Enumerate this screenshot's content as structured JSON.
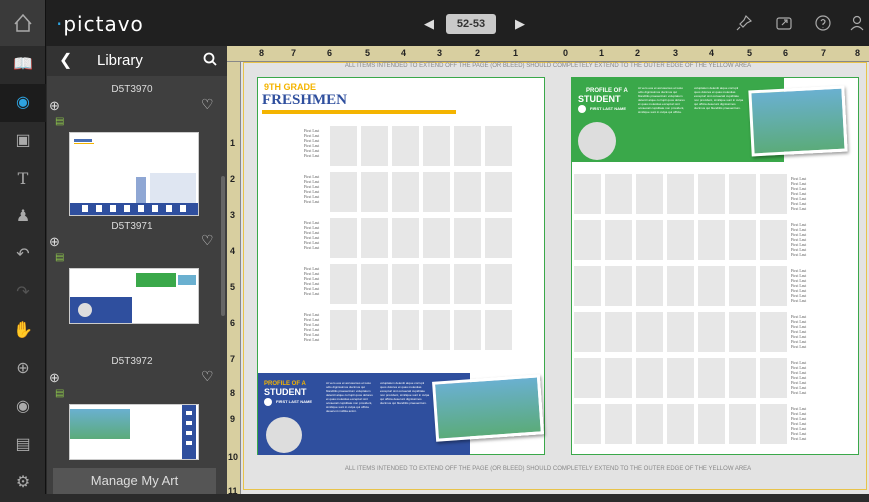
{
  "app": {
    "logo_prefix": "·",
    "logo_text": "pictavo"
  },
  "top": {
    "page_indicator": "52-53",
    "prev": "◀",
    "next": "▶"
  },
  "library": {
    "title": "Library",
    "items": [
      {
        "label": "D5T3970"
      },
      {
        "label": "D5T3971"
      },
      {
        "label": "D5T3972"
      }
    ],
    "manage_label": "Manage My Art"
  },
  "canvas": {
    "bleed_notice": "ALL ITEMS INTENDED TO EXTEND OFF THE PAGE (OR BLEED) SHOULD COMPLETELY EXTEND TO THE OUTER EDGE OF THE YELLOW AREA",
    "ruler_top": [
      "8",
      "7",
      "6",
      "5",
      "4",
      "3",
      "2",
      "1",
      "0",
      "1",
      "2",
      "3",
      "4",
      "5",
      "6",
      "7",
      "8"
    ],
    "ruler_left": [
      "1",
      "2",
      "3",
      "4",
      "5",
      "6",
      "7",
      "8",
      "9",
      "10",
      "11"
    ]
  },
  "left_page": {
    "kicker": "9TH GRADE",
    "title": "FRESHMEN",
    "name_line": "First Last",
    "banner": {
      "kicker": "PROFILE OF A",
      "title": "STUDENT",
      "subtitle": "FIRST LAST NAME",
      "col1": "At vero eos et accusamus et iusto odio dignissimos ducimus qui blanditiis praesentium voluptatum deleniti atque corrupti quos dolores et quas molestias excepturi sint occaecati cupiditate non provident, similique sunt in culpa qui officia deserunt mollitia animi.",
      "col2": "voluptatum deleniti atque corrupti quos dolores et quas molestias excepturi sint occaecati cupiditate non provident, similique sunt in culpa qui officia deserunt dignissimos ducimus qui blanditiis praesentium."
    }
  },
  "right_page": {
    "name_line": "First Last",
    "banner": {
      "kicker": "PROFILE OF A",
      "title": "STUDENT",
      "subtitle": "FIRST LAST NAME",
      "col1": "At vero eos et accusamus et iusto odio dignissimos ducimus qui blanditiis praesentium voluptatum deleniti atque corrupti quos dolores et quas molestias excepturi sint occaecati cupiditate non provident, similique sunt in culpa qui officia.",
      "col2": "voluptatum deleniti atque corrupti quos dolores et quas molestias excepturi sint occaecati cupiditate non provident, similique sunt in culpa qui officia deserunt dignissimos ducimus qui blanditiis praesentium."
    }
  },
  "colors": {
    "accent": "#2ea3e0",
    "green": "#3aa84a",
    "navy": "#2f4f9e",
    "yellow": "#f4b400"
  }
}
